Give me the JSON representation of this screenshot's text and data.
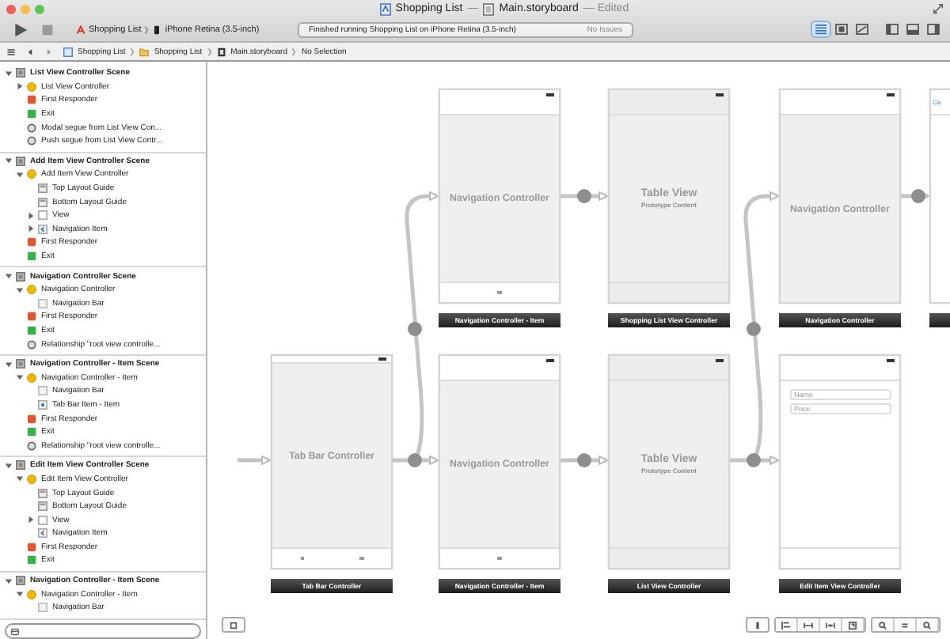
{
  "window": {
    "project": "Shopping List",
    "separator": "—",
    "file": "Main.storyboard",
    "status": "— Edited"
  },
  "toolbar": {
    "scheme": "Shopping List",
    "device": "iPhone Retina (3.5-inch)",
    "status": "Finished running Shopping List on iPhone Retina (3.5-inch)",
    "issues": "No Issues",
    "editor_modes": [
      {
        "kind": "standard",
        "selected": true
      },
      {
        "kind": "assistant",
        "selected": false
      },
      {
        "kind": "version",
        "selected": false
      }
    ],
    "panels": [
      {
        "kind": "navigator"
      },
      {
        "kind": "debug"
      },
      {
        "kind": "utilities"
      }
    ]
  },
  "jump_bar": {
    "crumbs": [
      {
        "kind": "project",
        "label": "Shopping List"
      },
      {
        "kind": "folder",
        "label": "Shopping List"
      },
      {
        "kind": "storyboard",
        "label": "Main.storyboard"
      },
      {
        "kind": "none",
        "label": "No Selection"
      }
    ]
  },
  "outline": {
    "scenes": [
      {
        "title": "List View Controller Scene",
        "expanded": true,
        "children": [
          {
            "label": "List View Controller",
            "kind": "controller",
            "expanded": false
          },
          {
            "label": "First Responder",
            "kind": "responder"
          },
          {
            "label": "Exit",
            "kind": "exit"
          },
          {
            "label": "Modal segue from List View Con...",
            "kind": "segue"
          },
          {
            "label": "Push segue from List View Contr...",
            "kind": "segue"
          }
        ]
      },
      {
        "title": "Add Item View Controller Scene",
        "expanded": true,
        "children": [
          {
            "label": "Add Item View Controller",
            "kind": "controller",
            "expanded": true,
            "children": [
              {
                "label": "Top Layout Guide",
                "kind": "guide"
              },
              {
                "label": "Bottom Layout Guide",
                "kind": "guide"
              },
              {
                "label": "View",
                "kind": "view",
                "expanded": false
              },
              {
                "label": "Navigation Item",
                "kind": "nav-item",
                "expanded": false
              }
            ]
          },
          {
            "label": "First Responder",
            "kind": "responder"
          },
          {
            "label": "Exit",
            "kind": "exit"
          }
        ]
      },
      {
        "title": "Navigation Controller Scene",
        "expanded": true,
        "children": [
          {
            "label": "Navigation Controller",
            "kind": "nav-controller",
            "expanded": true,
            "children": [
              {
                "label": "Navigation Bar",
                "kind": "nav-bar"
              }
            ]
          },
          {
            "label": "First Responder",
            "kind": "responder"
          },
          {
            "label": "Exit",
            "kind": "exit"
          },
          {
            "label": "Relationship \"root view controlle...",
            "kind": "segue"
          }
        ]
      },
      {
        "title": "Navigation Controller - Item Scene",
        "expanded": true,
        "children": [
          {
            "label": "Navigation Controller - Item",
            "kind": "nav-controller",
            "expanded": true,
            "children": [
              {
                "label": "Navigation Bar",
                "kind": "nav-bar"
              },
              {
                "label": "Tab Bar Item - Item",
                "kind": "tab-item"
              }
            ]
          },
          {
            "label": "First Responder",
            "kind": "responder"
          },
          {
            "label": "Exit",
            "kind": "exit"
          },
          {
            "label": "Relationship \"root view controlle...",
            "kind": "segue"
          }
        ]
      },
      {
        "title": "Edit Item View Controller Scene",
        "expanded": true,
        "children": [
          {
            "label": "Edit Item View Controller",
            "kind": "controller",
            "expanded": true,
            "children": [
              {
                "label": "Top Layout Guide",
                "kind": "guide"
              },
              {
                "label": "Bottom Layout Guide",
                "kind": "guide"
              },
              {
                "label": "View",
                "kind": "view",
                "expanded": false
              },
              {
                "label": "Navigation Item",
                "kind": "nav-item"
              }
            ]
          },
          {
            "label": "First Responder",
            "kind": "responder"
          },
          {
            "label": "Exit",
            "kind": "exit"
          }
        ]
      },
      {
        "title": "Navigation Controller - Item Scene",
        "expanded": true,
        "children": [
          {
            "label": "Navigation Controller - Item",
            "kind": "nav-controller",
            "expanded": true,
            "children": [
              {
                "label": "Navigation Bar",
                "kind": "nav-bar"
              }
            ]
          }
        ]
      }
    ]
  },
  "canvas": {
    "scenes": [
      {
        "kind": "navigation",
        "title": "Navigation Controller",
        "label": "Navigation Controller - Item",
        "tab_items": [
          {
            "kind": "item"
          }
        ]
      },
      {
        "kind": "table",
        "title": "Table View",
        "subtitle": "Prototype Content",
        "label": "Shopping List View Controller"
      },
      {
        "kind": "navigation",
        "title": "Navigation Controller",
        "label": "Navigation Controller"
      },
      {
        "kind": "partial",
        "button": "Ca"
      },
      {
        "kind": "tabbar",
        "title": "Tab Bar Controller",
        "label": "Tab Bar Controller",
        "tab_items": [
          {
            "kind": "item"
          },
          {
            "kind": "item"
          }
        ]
      },
      {
        "kind": "navigation",
        "title": "Navigation Controller",
        "label": "Navigation Controller - Item",
        "tab_items": [
          {
            "kind": "item"
          }
        ]
      },
      {
        "kind": "table",
        "title": "Table View",
        "subtitle": "Prototype Content",
        "label": "List View Controller"
      },
      {
        "kind": "form",
        "fields": [
          {
            "placeholder": "Name"
          },
          {
            "placeholder": "Price"
          }
        ],
        "label": "Edit Item View Controller"
      }
    ]
  }
}
